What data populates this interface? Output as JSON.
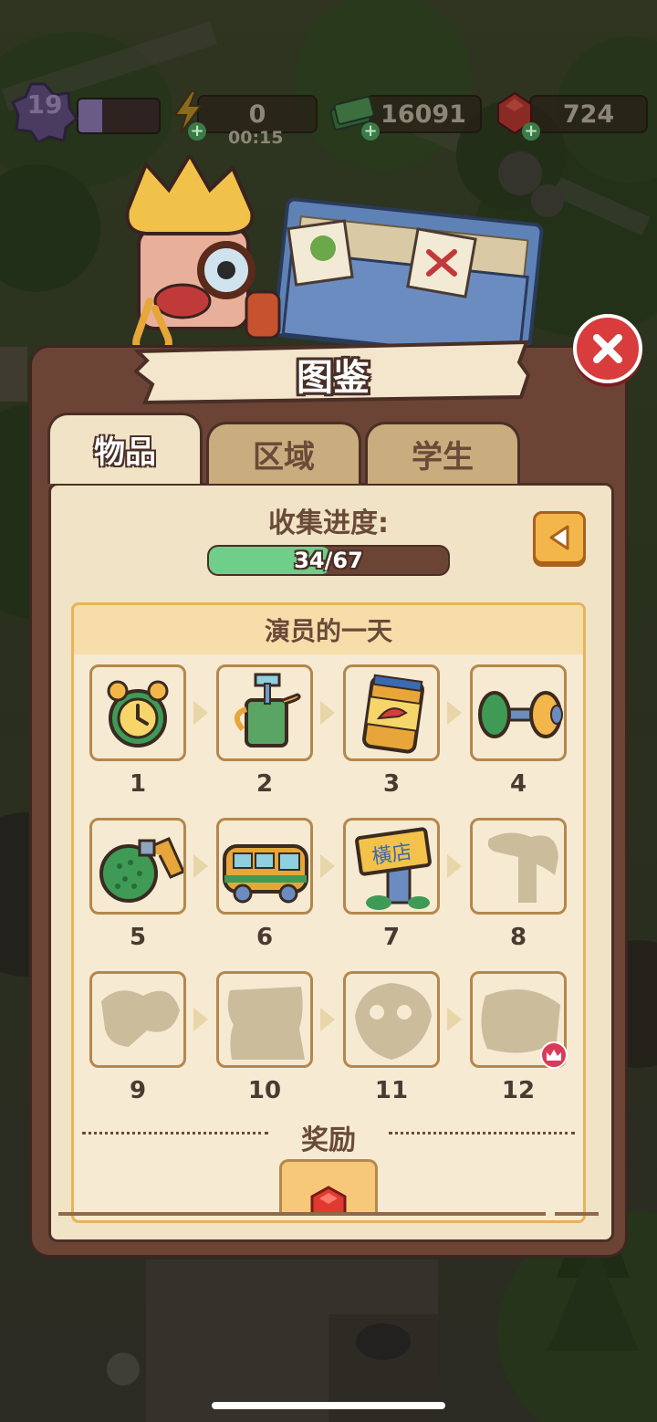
{
  "hud": {
    "level": "19",
    "energy": "0",
    "energy_timer": "00:15",
    "cash": "16091",
    "gems": "724"
  },
  "dialog": {
    "title": "图鉴",
    "tabs": [
      {
        "label": "物品",
        "active": true
      },
      {
        "label": "区域",
        "active": false
      },
      {
        "label": "学生",
        "active": false
      }
    ],
    "progress_label": "收集进度:",
    "progress_text": "34/67",
    "progress_fraction": 0.507
  },
  "collection": {
    "title": "演员的一天",
    "items": [
      {
        "num": "1",
        "icon": "alarm-clock-icon",
        "unlocked": true
      },
      {
        "num": "2",
        "icon": "toothbrush-cup-icon",
        "unlocked": true
      },
      {
        "num": "3",
        "icon": "energy-drink-can-icon",
        "unlocked": true
      },
      {
        "num": "4",
        "icon": "dumbbell-icon",
        "unlocked": true
      },
      {
        "num": "5",
        "icon": "shower-head-icon",
        "unlocked": true
      },
      {
        "num": "6",
        "icon": "van-icon",
        "unlocked": true
      },
      {
        "num": "7",
        "icon": "hengdian-sign-icon",
        "unlocked": true
      },
      {
        "num": "8",
        "icon": "locked-silhouette-icon",
        "unlocked": false
      },
      {
        "num": "9",
        "icon": "locked-silhouette-icon",
        "unlocked": false
      },
      {
        "num": "10",
        "icon": "locked-silhouette-icon",
        "unlocked": false
      },
      {
        "num": "11",
        "icon": "locked-silhouette-icon",
        "unlocked": false
      },
      {
        "num": "12",
        "icon": "locked-silhouette-icon",
        "unlocked": false,
        "crown": true
      }
    ],
    "reward_title": "奖励",
    "reward_icon": "ruby-gem-icon"
  },
  "colors": {
    "panel": "#6b4436",
    "panel_inner": "#f1e3c5",
    "progress_fill": "#6fce8a",
    "close": "#d83c3c",
    "accent": "#f3b64a"
  }
}
